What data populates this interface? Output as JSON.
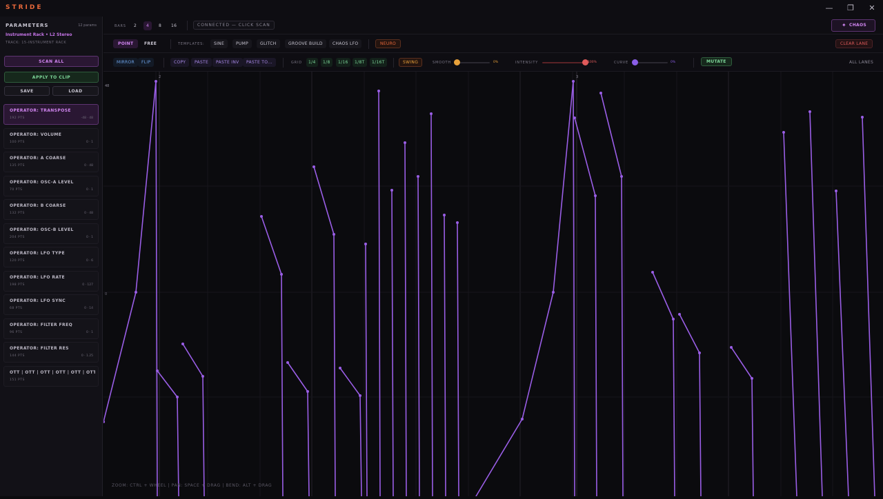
{
  "app": {
    "logo": "STRIDE",
    "window_controls": [
      "minimize-icon",
      "restore-icon",
      "close-icon"
    ]
  },
  "sidebar": {
    "header": "PARAMETERS",
    "count": "12 params",
    "track_name": "Instrument Rack • L2 Stereo",
    "track_sub": "TRACK: 15-INSTRUMENT RACK",
    "scan_all": "SCAN ALL",
    "apply_to_clip": "APPLY TO CLIP",
    "save": "SAVE",
    "load": "LOAD",
    "lanes": [
      {
        "name": "OPERATOR: TRANSPOSE",
        "pts": "192 PTS",
        "range": "-48 · 48",
        "active": true
      },
      {
        "name": "OPERATOR: VOLUME",
        "pts": "100 PTS",
        "range": "0 · 1"
      },
      {
        "name": "OPERATOR: A COARSE",
        "pts": "135 PTS",
        "range": "0 · 48"
      },
      {
        "name": "OPERATOR: OSC-A LEVEL",
        "pts": "70 PTS",
        "range": "0 · 1"
      },
      {
        "name": "OPERATOR: B COARSE",
        "pts": "132 PTS",
        "range": "0 · 48"
      },
      {
        "name": "OPERATOR: OSC-B LEVEL",
        "pts": "204 PTS",
        "range": "0 · 1"
      },
      {
        "name": "OPERATOR: LFO TYPE",
        "pts": "120 PTS",
        "range": "0 · 6"
      },
      {
        "name": "OPERATOR: LFO RATE",
        "pts": "198 PTS",
        "range": "0 · 127"
      },
      {
        "name": "OPERATOR: LFO SYNC",
        "pts": "68 PTS",
        "range": "0 · 14"
      },
      {
        "name": "OPERATOR: FILTER FREQ",
        "pts": "96 PTS",
        "range": "0 · 1"
      },
      {
        "name": "OPERATOR: FILTER RES",
        "pts": "144 PTS",
        "range": "0 · 1.25"
      },
      {
        "name": "OTT | OTT | OTT | OTT | OTT | OTT | OTT",
        "pts": "151 PTS",
        "range": ""
      }
    ]
  },
  "toolbar": {
    "bars_label": "BARS",
    "bars_options": [
      "2",
      "4",
      "8",
      "16"
    ],
    "bars_selected": "4",
    "connection": "CONNECTED — CLICK SCAN",
    "chaos": "CHAOS",
    "mode_point": "POINT",
    "mode_free": "FREE",
    "templates_label": "TEMPLATES:",
    "templates": [
      "SINE",
      "PUMP",
      "GLITCH",
      "GROOVE BUILD",
      "CHAOS LFO"
    ],
    "neuro": "NEURO",
    "clear_lane": "CLEAR LANE",
    "mirror": "MIRROR",
    "flip": "FLIP",
    "clip_ops": [
      "COPY",
      "PASTE",
      "PASTE INV",
      "PASTE TO..."
    ],
    "grid_label": "GRID",
    "grid_options": [
      "1/4",
      "1/8",
      "1/16",
      "1/8T",
      "1/16T"
    ],
    "swing": "SWING",
    "smooth_label": "SMOOTH",
    "smooth_value": "0%",
    "smooth_level": 0,
    "intensity_label": "INTENSITY",
    "intensity_value": "100%",
    "intensity_level": 1,
    "curve_label": "CURVE",
    "curve_value": "0%",
    "curve_level": 0,
    "mutate": "MUTATE",
    "all_lanes": "ALL LANES"
  },
  "graph": {
    "y_max_label": "48",
    "y_mid_label": "0",
    "bar_markers": [
      "2",
      "3"
    ],
    "hint": "ZOOM: CTRL + WHEEL | PAN: SPACE + DRAG | BEND: ALT + DRAG",
    "line_color": "#9a5ee6"
  },
  "colors": {
    "accent_purple": "#c675e8",
    "accent_orange": "#e8683a",
    "accent_green": "#7ed89a",
    "accent_blue": "#6fa3e8",
    "accent_red": "#e05a5a"
  }
}
